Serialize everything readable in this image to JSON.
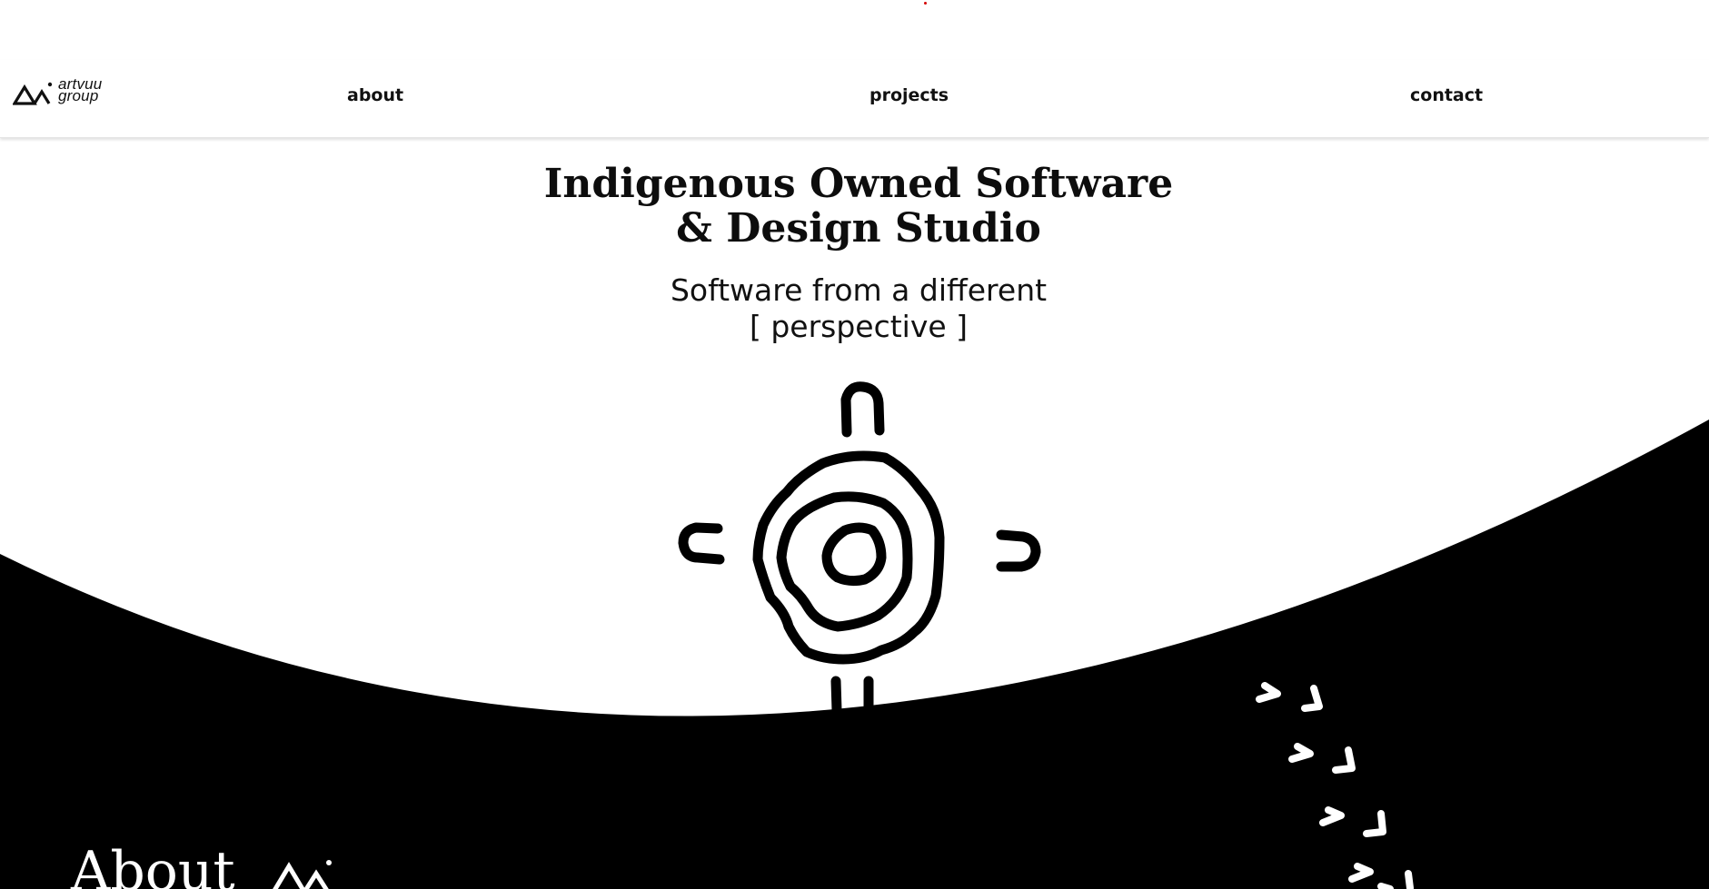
{
  "logo": {
    "line1": "artvuu",
    "line2": "group"
  },
  "nav": {
    "about": "about",
    "projects": "projects",
    "contact": "contact"
  },
  "hero": {
    "title_line1": "Indigenous Owned Software",
    "title_line2": "& Design Studio",
    "subtitle_line1": "Software from a different",
    "subtitle_line2": "[ perspective ]"
  },
  "about": {
    "heading": "About"
  },
  "colors": {
    "background": "#ffffff",
    "dark": "#000000",
    "text": "#111111",
    "accent_dot": "#d40000"
  },
  "icons": {
    "logo_mark": "mountain-logo-icon",
    "emblem": "meeting-place-symbol-icon",
    "chevrons": "chevron-track-icon"
  }
}
